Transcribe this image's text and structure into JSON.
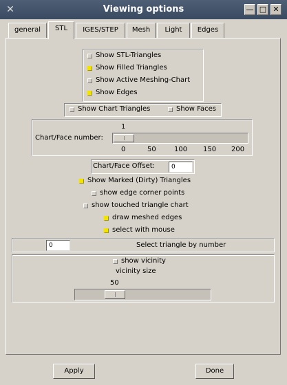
{
  "window": {
    "title": "Viewing options",
    "logo_glyph": "✕",
    "min_glyph": "—",
    "max_glyph": "□",
    "close_glyph": "✕"
  },
  "tabs": [
    {
      "label": "general"
    },
    {
      "label": "STL"
    },
    {
      "label": "IGES/STEP"
    },
    {
      "label": "Mesh"
    },
    {
      "label": "Light"
    },
    {
      "label": "Edges"
    }
  ],
  "active_tab": "STL",
  "display_group": {
    "items": [
      {
        "label": "Show STL-Triangles",
        "checked": false
      },
      {
        "label": "Show Filled Triangles",
        "checked": true
      },
      {
        "label": "Show Active Meshing-Chart",
        "checked": false
      },
      {
        "label": "Show Edges",
        "checked": true
      }
    ]
  },
  "chart_group": {
    "show_chart_triangles": {
      "label": "Show Chart Triangles",
      "checked": false
    },
    "show_faces": {
      "label": "Show Faces",
      "checked": false
    }
  },
  "chart_face_number": {
    "label": "Chart/Face number:",
    "value": "1",
    "min": 0,
    "max": 200,
    "ticks": [
      "0",
      "50",
      "100",
      "150",
      "200"
    ]
  },
  "chart_face_offset": {
    "label": "Chart/Face Offset:",
    "value": "0"
  },
  "options": [
    {
      "label": "Show Marked (Dirty) Triangles",
      "checked": true
    },
    {
      "label": "show edge corner points",
      "checked": false
    },
    {
      "label": "show touched triangle chart",
      "checked": false
    },
    {
      "label": "draw meshed edges",
      "checked": true
    },
    {
      "label": "select with mouse",
      "checked": true
    }
  ],
  "select_triangle": {
    "value": "0",
    "label": "Select triangle by number"
  },
  "vicinity": {
    "show_label": "show vicinity",
    "show_checked": false,
    "size_label": "vicinity size",
    "value": "50",
    "fraction": 0.25
  },
  "buttons": {
    "apply": "Apply",
    "done": "Done"
  },
  "colors": {
    "check_on": "#f3e300",
    "titlebar": "#43536a"
  }
}
